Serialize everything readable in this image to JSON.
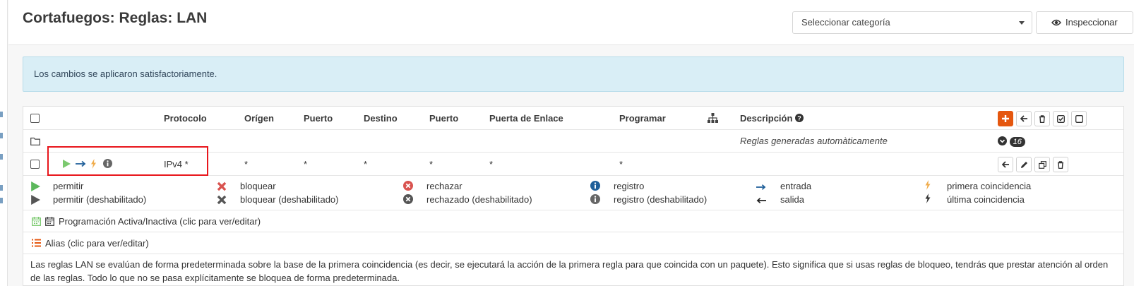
{
  "header": {
    "title": "Cortafuegos: Reglas: LAN",
    "category_select_placeholder": "Seleccionar categoría",
    "inspect_label": "Inspeccionar"
  },
  "alert": {
    "text": "Los cambios se aplicaron satisfactoriamente."
  },
  "table": {
    "columns": [
      "Protocolo",
      "Orígen",
      "Puerto",
      "Destino",
      "Puerto",
      "Puerta de Enlace",
      "Programar",
      "Descripción"
    ],
    "auto_rules_description": "Reglas generadas automàticamente",
    "auto_rules_count": "16",
    "rule": {
      "protocol": "IPv4 *",
      "source": "*",
      "source_port": "*",
      "destination": "*",
      "destination_port": "*",
      "gateway": "*",
      "schedule": "*",
      "description": ""
    }
  },
  "legend": {
    "pass": "permitir",
    "pass_disabled": "permitir (deshabilitado)",
    "block": "bloquear",
    "block_disabled": "bloquear (deshabilitado)",
    "reject": "rechazar",
    "reject_disabled": "rechazado (deshabilitado)",
    "log": "registro",
    "log_disabled": "registro (deshabilitado)",
    "in": "entrada",
    "out": "salida",
    "first_match": "primera coincidencia",
    "last_match": "última coincidencia",
    "schedule": "Programación Activa/Inactiva (clic para ver/editar)",
    "alias": "Alias (clic para ver/editar)"
  },
  "note": "Las reglas LAN se evalúan de forma predeterminada sobre la base de la primera coincidencia (es decir, se ejecutará la acción de la primera regla para que coincida con un paquete). Esto significa que si usas reglas de bloqueo, tendrás que prestar atención al orden de las reglas. Todo lo que no se pasa explícitamente se bloquea de forma predeterminada.",
  "colors": {
    "accent": "#e5570f",
    "pass": "#5cb85c",
    "block": "#d9534f",
    "first_match": "#f0ad4e",
    "direction": "#1f5f99",
    "alert_bg": "#d9eef6",
    "highlight": "#e8161c"
  }
}
